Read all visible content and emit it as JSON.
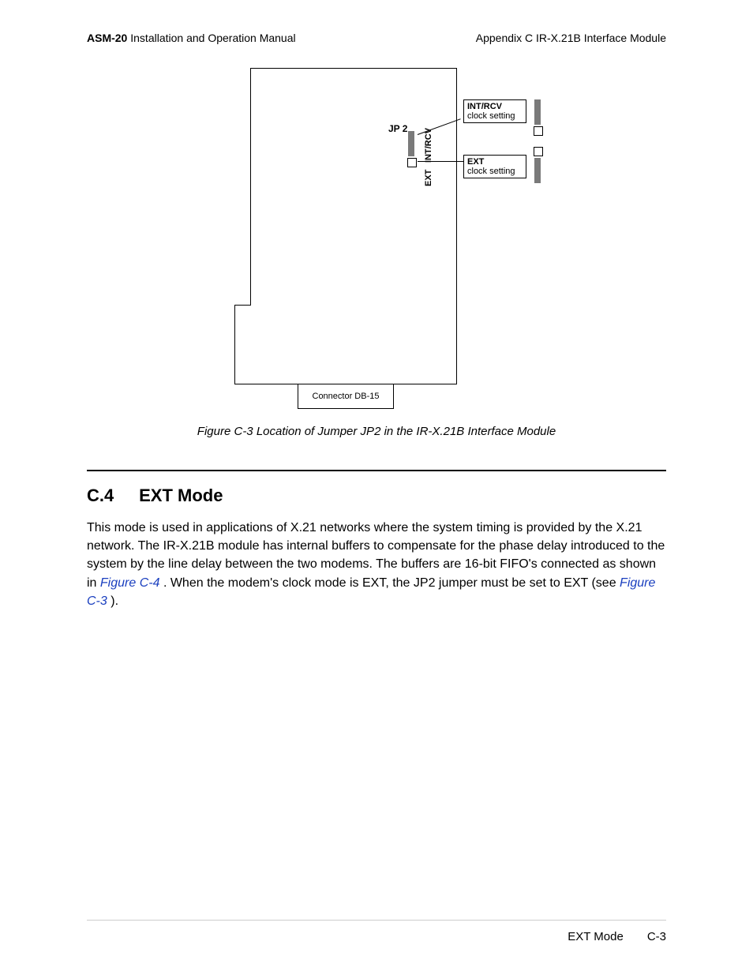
{
  "header": {
    "product": "ASM-20",
    "doc_title": "Installation and Operation Manual",
    "appendix": "Appendix C  IR-X.21B Interface Module"
  },
  "diagram": {
    "jp2_label": "JP 2",
    "vtext_top": "INT/RCV",
    "vtext_bottom": "EXT",
    "callout1_title": "INT/RCV",
    "callout1_sub": "clock setting",
    "callout2_title": "EXT",
    "callout2_sub": "clock setting",
    "connector_label": "Connector DB-15"
  },
  "caption": "Figure C-3  Location of Jumper JP2 in the IR-X.21B Interface Module",
  "section": {
    "number": "C.4",
    "title": "EXT Mode",
    "para_a": "This mode is used in applications of X.21 networks where the system timing is provided by the X.21 network. The IR-X.21B module has internal buffers to compensate for the phase delay introduced to the system by the line delay between the two modems. The buffers are 16-bit FIFO's connected as shown in ",
    "xref1": "Figure C-4",
    "para_b": ". When the modem's clock mode is EXT, the JP2 jumper must be set to EXT (see ",
    "xref2": "Figure C-3",
    "para_c": ")."
  },
  "footer": {
    "section": "EXT Mode",
    "page": "C-3"
  }
}
